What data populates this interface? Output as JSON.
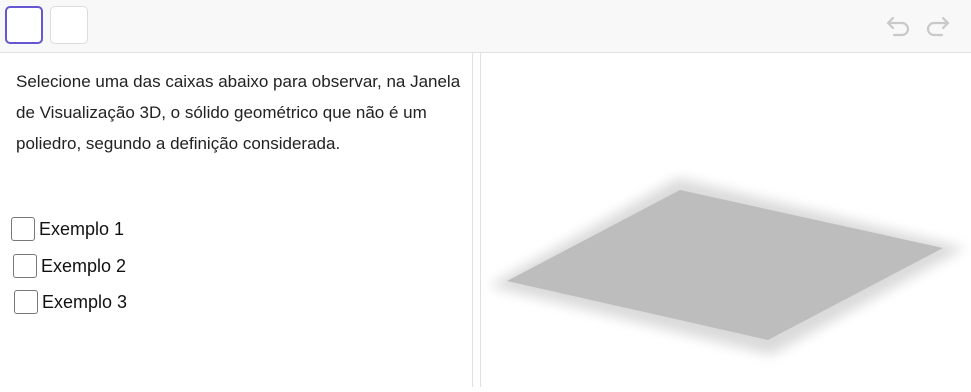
{
  "toolbar": {
    "tools": [
      {
        "name": "tool-button-1",
        "selected": true
      },
      {
        "name": "tool-button-2",
        "selected": false
      }
    ],
    "undo_icon": "undo-icon",
    "redo_icon": "redo-icon"
  },
  "instructions": "Selecione uma das caixas abaixo para observar, na Janela de Visualização 3D, o sólido geométrico que não é um poliedro, segundo a definição considerada.",
  "checkboxes": [
    {
      "label": "Exemplo 1",
      "checked": false
    },
    {
      "label": "Exemplo 2",
      "checked": false
    },
    {
      "label": "Exemplo 3",
      "checked": false
    }
  ],
  "view3d": {
    "plane_color": "#bdbdbd"
  }
}
